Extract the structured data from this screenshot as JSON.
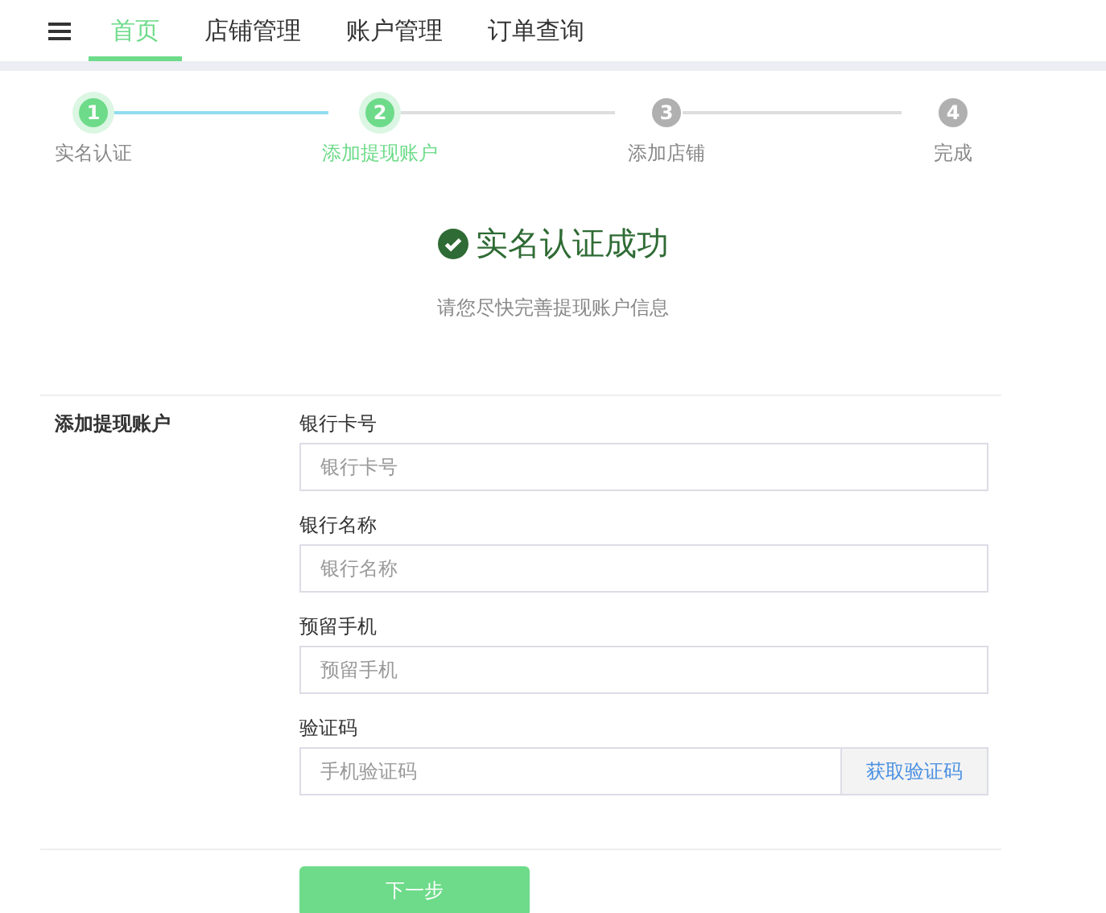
{
  "nav": {
    "tabs": [
      {
        "label": "首页",
        "selected": true
      },
      {
        "label": "店铺管理",
        "selected": false
      },
      {
        "label": "账户管理",
        "selected": false
      },
      {
        "label": "订单查询",
        "selected": false
      }
    ]
  },
  "steps": [
    {
      "number": "1",
      "label": "实名认证",
      "selected": false
    },
    {
      "number": "2",
      "label": "添加提现账户",
      "selected": true
    },
    {
      "number": "3",
      "label": "添加店铺",
      "selected": false
    },
    {
      "number": "4",
      "label": "完成",
      "selected": false
    }
  ],
  "success": {
    "title": "实名认证成功",
    "subtitle": "请您尽快完善提现账户信息"
  },
  "form": {
    "section_label": "添加提现账户",
    "fields": [
      {
        "label": "银行卡号",
        "placeholder": "银行卡号"
      },
      {
        "label": "银行名称",
        "placeholder": "银行名称"
      },
      {
        "label": "预留手机",
        "placeholder": "预留手机"
      },
      {
        "label": "验证码",
        "placeholder": "手机验证码",
        "button": "获取验证码"
      }
    ],
    "submit": "下一步"
  }
}
